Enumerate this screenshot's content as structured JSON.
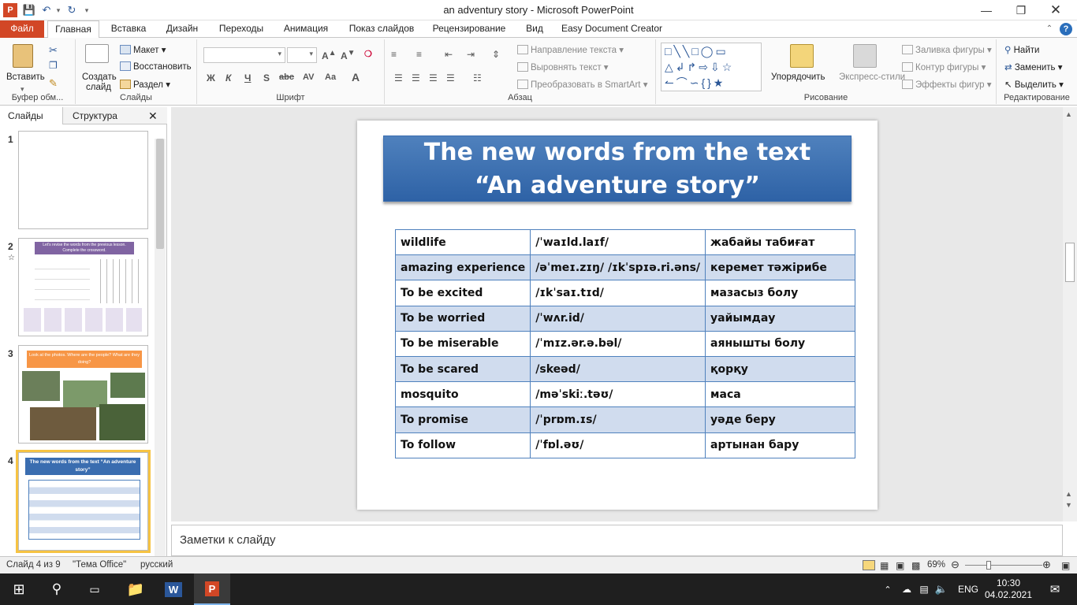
{
  "window": {
    "title": "an adventury story  -  Microsoft PowerPoint"
  },
  "tabs": [
    "Файл",
    "Главная",
    "Вставка",
    "Дизайн",
    "Переходы",
    "Анимация",
    "Показ слайдов",
    "Рецензирование",
    "Вид",
    "Easy Document Creator"
  ],
  "ribbon": {
    "clipboard": {
      "paste": "Вставить",
      "label": "Буфер обм..."
    },
    "slides": {
      "new_slide": "Создать слайд",
      "layout": "Макет",
      "reset": "Восстановить",
      "section": "Раздел",
      "label": "Слайды"
    },
    "font": {
      "label": "Шрифт",
      "bold": "Ж",
      "italic": "К",
      "underline": "Ч",
      "strike": "abc",
      "shadow": "S"
    },
    "paragraph": {
      "label": "Абзац",
      "text_direction": "Направление текста",
      "align_text": "Выровнять текст",
      "smartart": "Преобразовать в SmartArt"
    },
    "drawing": {
      "label": "Рисование",
      "arrange": "Упорядочить",
      "quick_styles": "Экспресс-стили",
      "fill": "Заливка фигуры",
      "outline": "Контур фигуры",
      "effects": "Эффекты фигур"
    },
    "editing": {
      "label": "Редактирование",
      "find": "Найти",
      "replace": "Заменить",
      "select": "Выделить"
    }
  },
  "leftpane": {
    "tab_slides": "Слайды",
    "tab_outline": "Структура",
    "thumb_numbers": [
      "1",
      "2",
      "3",
      "4"
    ],
    "thumb2_title": "Let's revise the words from the previous lesson. Complete the crossword.",
    "thumb3_title": "Look at the photos. Where are the people? What are they doing?",
    "thumb4_title": "The new words from the text “An adventure story”"
  },
  "slide": {
    "title_line1": "The new words from the text",
    "title_line2": "“An adventure story”",
    "rows": [
      [
        "wildlife",
        "/ˈwaɪld.laɪf/",
        "жабайы табиғат"
      ],
      [
        "amazing experience",
        "/əˈmeɪ.zɪŋ/ /ɪkˈspɪə.ri.əns/",
        "керемет тәжірибе"
      ],
      [
        "To be excited",
        "/ɪkˈsaɪ.tɪd/",
        "мазасыз болу"
      ],
      [
        "To be worried",
        "/ˈwʌr.id/",
        "уайымдау"
      ],
      [
        "To be miserable",
        "/ˈmɪz.ər.ə.bəl/",
        "аянышты болу"
      ],
      [
        "To be scared",
        " /skeəd/",
        "қорқу"
      ],
      [
        "mosquito",
        "/məˈskiː.təʊ/",
        "маса"
      ],
      [
        "To promise",
        "/ˈprɒm.ɪs/",
        "уәде беру"
      ],
      [
        "To follow",
        " /ˈfɒl.əʊ/",
        "артынан бару"
      ]
    ]
  },
  "notes": {
    "placeholder": "Заметки к слайду"
  },
  "status": {
    "slide": "Слайд 4 из 9",
    "theme": "\"Тема Office\"",
    "lang": "русский",
    "zoom": "69%"
  },
  "taskbar": {
    "time": "10:30",
    "date": "04.02.2021",
    "lang": "ENG"
  }
}
